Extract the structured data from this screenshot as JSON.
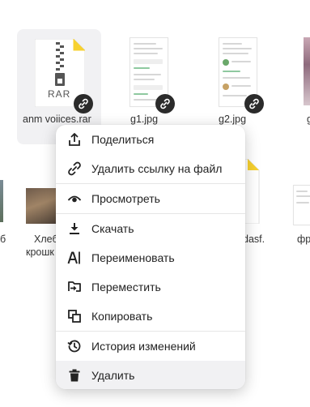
{
  "files_top": [
    {
      "name": "anm voiices.rar",
      "type_label": "RAR"
    },
    {
      "name": "g1.jpg"
    },
    {
      "name": "g2.jpg"
    },
    {
      "name": "g"
    }
  ],
  "files_bottom": [
    {
      "name": "б"
    },
    {
      "name_line1": "Хлеб",
      "name_line2": "крошк"
    },
    {
      "name": "dasf."
    },
    {
      "name": "фр"
    }
  ],
  "menu": {
    "items": [
      {
        "label": "Поделиться",
        "icon": "share-icon"
      },
      {
        "label": "Удалить ссылку на файл",
        "icon": "unlink-icon"
      },
      {
        "label": "Просмотреть",
        "icon": "eye-icon"
      },
      {
        "label": "Скачать",
        "icon": "download-icon"
      },
      {
        "label": "Переименовать",
        "icon": "rename-icon"
      },
      {
        "label": "Переместить",
        "icon": "move-icon"
      },
      {
        "label": "Копировать",
        "icon": "copy-icon"
      },
      {
        "label": "История изменений",
        "icon": "history-icon"
      },
      {
        "label": "Удалить",
        "icon": "trash-icon"
      }
    ]
  },
  "colors": {
    "accent_folder_corner": "#f7d12f",
    "badge": "#2b2b2b",
    "hover": "#f1f1f3"
  }
}
